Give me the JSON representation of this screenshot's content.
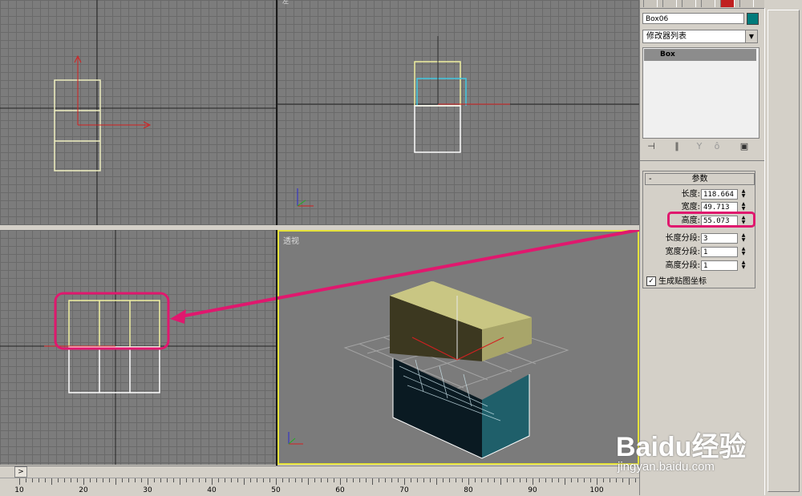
{
  "viewports": {
    "perspective_label": "透视",
    "right_label": "左"
  },
  "panel": {
    "object_name": "Box06",
    "object_color": "#007b7b",
    "modifier_list": "修改器列表",
    "stack_item": "Box",
    "rollout_title": "参数",
    "rollout_collapse": "-",
    "params": [
      {
        "label": "长度:",
        "value": "118.664"
      },
      {
        "label": "宽度:",
        "value": "49.713"
      },
      {
        "label": "高度:",
        "value": "55.073"
      },
      {
        "label": "长度分段:",
        "value": "3"
      },
      {
        "label": "宽度分段:",
        "value": "1"
      },
      {
        "label": "高度分段:",
        "value": "1"
      }
    ],
    "gen_mapping_label": "生成贴图坐标",
    "gen_mapping_checked": true
  },
  "timeline": {
    "arrow": ">",
    "ruler_numbers": [
      "10",
      "20",
      "30",
      "40",
      "50",
      "60",
      "70",
      "80",
      "90",
      "100"
    ]
  },
  "watermark": {
    "logo": "Baidu经验",
    "url": "jingyan.baidu.com"
  },
  "colors": {
    "highlight": "#e0186e",
    "viewport_active_border": "#e5e23a",
    "box_top": "#b8b574",
    "box_bottom": "#1f5f6a"
  }
}
